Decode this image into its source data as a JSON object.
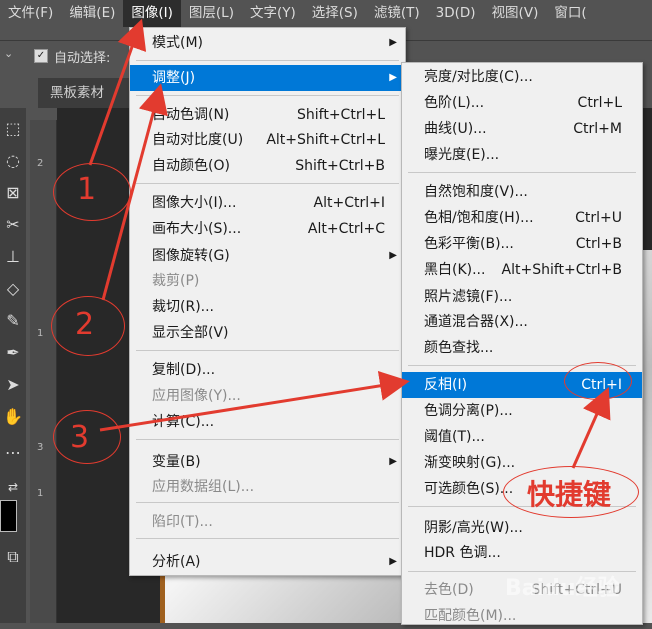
{
  "menubar": {
    "items": [
      "文件(F)",
      "编辑(E)",
      "图像(I)",
      "图层(L)",
      "文字(Y)",
      "选择(S)",
      "滤镜(T)",
      "3D(D)",
      "视图(V)",
      "窗口("
    ],
    "active_index": 2
  },
  "options_bar": {
    "auto_select_label": "自动选择:"
  },
  "document_tab": {
    "title": "黑板素材"
  },
  "ruler_marks": [
    "2",
    "1",
    "3",
    "1"
  ],
  "image_menu": {
    "items": [
      {
        "label": "模式(M)",
        "shortcut": "",
        "submenu": true
      },
      {
        "label": "调整(J)",
        "shortcut": "",
        "submenu": true,
        "highlight": true
      },
      {
        "label": "自动色调(N)",
        "shortcut": "Shift+Ctrl+L"
      },
      {
        "label": "自动对比度(U)",
        "shortcut": "Alt+Shift+Ctrl+L"
      },
      {
        "label": "自动颜色(O)",
        "shortcut": "Shift+Ctrl+B"
      },
      {
        "label": "图像大小(I)...",
        "shortcut": "Alt+Ctrl+I"
      },
      {
        "label": "画布大小(S)...",
        "shortcut": "Alt+Ctrl+C"
      },
      {
        "label": "图像旋转(G)",
        "shortcut": "",
        "submenu": true
      },
      {
        "label": "裁剪(P)",
        "shortcut": "",
        "disabled": true
      },
      {
        "label": "裁切(R)...",
        "shortcut": ""
      },
      {
        "label": "显示全部(V)",
        "shortcut": ""
      },
      {
        "label": "复制(D)...",
        "shortcut": ""
      },
      {
        "label": "应用图像(Y)...",
        "shortcut": "",
        "disabled": true
      },
      {
        "label": "计算(C)...",
        "shortcut": ""
      },
      {
        "label": "变量(B)",
        "shortcut": "",
        "submenu": true
      },
      {
        "label": "应用数据组(L)...",
        "shortcut": "",
        "disabled": true
      },
      {
        "label": "陷印(T)...",
        "shortcut": "",
        "disabled": true
      },
      {
        "label": "分析(A)",
        "shortcut": "",
        "submenu": true
      }
    ]
  },
  "adjust_menu": {
    "items": [
      {
        "label": "亮度/对比度(C)...",
        "shortcut": ""
      },
      {
        "label": "色阶(L)...",
        "shortcut": "Ctrl+L"
      },
      {
        "label": "曲线(U)...",
        "shortcut": "Ctrl+M"
      },
      {
        "label": "曝光度(E)...",
        "shortcut": ""
      },
      {
        "label": "自然饱和度(V)...",
        "shortcut": ""
      },
      {
        "label": "色相/饱和度(H)...",
        "shortcut": "Ctrl+U"
      },
      {
        "label": "色彩平衡(B)...",
        "shortcut": "Ctrl+B"
      },
      {
        "label": "黑白(K)...",
        "shortcut": "Alt+Shift+Ctrl+B"
      },
      {
        "label": "照片滤镜(F)...",
        "shortcut": ""
      },
      {
        "label": "通道混合器(X)...",
        "shortcut": ""
      },
      {
        "label": "颜色查找...",
        "shortcut": ""
      },
      {
        "label": "反相(I)",
        "shortcut": "Ctrl+I",
        "highlight": true
      },
      {
        "label": "色调分离(P)...",
        "shortcut": ""
      },
      {
        "label": "阈值(T)...",
        "shortcut": ""
      },
      {
        "label": "渐变映射(G)...",
        "shortcut": ""
      },
      {
        "label": "可选颜色(S)...",
        "shortcut": ""
      },
      {
        "label": "阴影/高光(W)...",
        "shortcut": ""
      },
      {
        "label": "HDR 色调...",
        "shortcut": ""
      },
      {
        "label": "去色(D)",
        "shortcut": "Shift+Ctrl+U",
        "disabled": true
      },
      {
        "label": "匹配颜色(M)...",
        "shortcut": "",
        "disabled": true
      }
    ]
  },
  "annotations": {
    "step1": "1",
    "step2": "2",
    "step3": "3",
    "shortcut_note": "快捷键"
  },
  "watermark": "Baidu经验",
  "colors": {
    "accent": "#0078d7",
    "annotation": "#e23b2f",
    "menu_bg": "#f0f0f0",
    "app_bg": "#535353"
  }
}
